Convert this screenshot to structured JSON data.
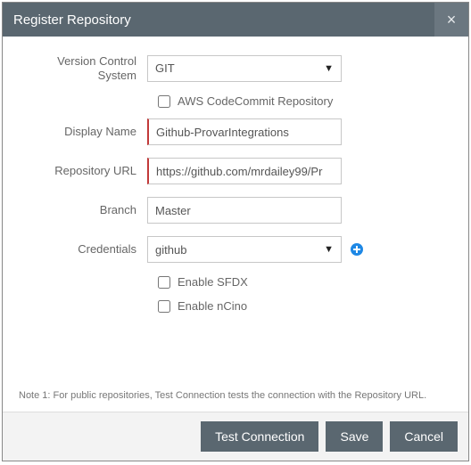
{
  "dialog": {
    "title": "Register Repository"
  },
  "form": {
    "vcs": {
      "label": "Version Control System",
      "value": "GIT"
    },
    "aws": {
      "label": "AWS CodeCommit Repository",
      "checked": false
    },
    "displayName": {
      "label": "Display Name",
      "value": "Github-ProvarIntegrations"
    },
    "repoUrl": {
      "label": "Repository URL",
      "value": "https://github.com/mrdailey99/Pr"
    },
    "branch": {
      "label": "Branch",
      "value": "Master"
    },
    "credentials": {
      "label": "Credentials",
      "value": "github"
    },
    "sfdx": {
      "label": "Enable SFDX",
      "checked": false
    },
    "ncino": {
      "label": "Enable nCino",
      "checked": false
    }
  },
  "note": "Note 1: For public repositories, Test Connection tests the connection with the Repository URL.",
  "footer": {
    "test": "Test Connection",
    "save": "Save",
    "cancel": "Cancel"
  }
}
